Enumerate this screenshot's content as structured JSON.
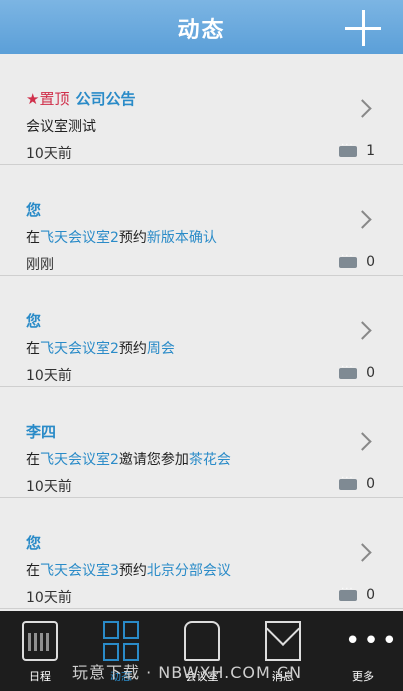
{
  "header": {
    "title": "动态"
  },
  "feed": [
    {
      "pin": "★置顶",
      "author": "公司公告",
      "message_parts": [
        {
          "t": "会议室测试",
          "link": false
        }
      ],
      "time": "10天前",
      "comments": "1"
    },
    {
      "author": "您",
      "message_parts": [
        {
          "t": "在",
          "link": false
        },
        {
          "t": "飞天会议室2",
          "link": true
        },
        {
          "t": "预约",
          "link": false
        },
        {
          "t": "新版本确认",
          "link": true
        }
      ],
      "time": "刚刚",
      "comments": "0"
    },
    {
      "author": "您",
      "message_parts": [
        {
          "t": "在",
          "link": false
        },
        {
          "t": "飞天会议室2",
          "link": true
        },
        {
          "t": "预约",
          "link": false
        },
        {
          "t": "周会",
          "link": true
        }
      ],
      "time": "10天前",
      "comments": "0"
    },
    {
      "author": "李四",
      "message_parts": [
        {
          "t": "在",
          "link": false
        },
        {
          "t": "飞天会议室2",
          "link": true
        },
        {
          "t": "邀请您参加",
          "link": false
        },
        {
          "t": "茶花会",
          "link": true
        }
      ],
      "time": "10天前",
      "comments": "0"
    },
    {
      "author": "您",
      "message_parts": [
        {
          "t": "在",
          "link": false
        },
        {
          "t": "飞天会议室3",
          "link": true
        },
        {
          "t": "预约",
          "link": false
        },
        {
          "t": "北京分部会议",
          "link": true
        }
      ],
      "time": "10天前",
      "comments": "0"
    }
  ],
  "tabs": [
    {
      "label": "日程"
    },
    {
      "label": "动态"
    },
    {
      "label": "会议室"
    },
    {
      "label": "消息"
    },
    {
      "label": "更多"
    }
  ],
  "watermark": "玩意下载 · NBWXH.COM.CN",
  "colors": {
    "header": "#6aaae0",
    "link": "#2a8bc8",
    "pin": "#d0304b",
    "tabbar": "#1d1d1d"
  }
}
